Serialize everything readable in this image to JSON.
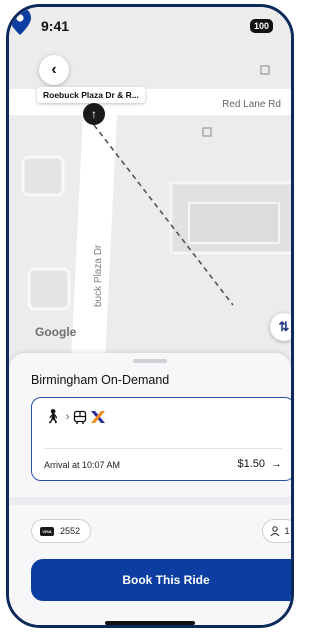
{
  "status_bar": {
    "time": "9:41",
    "battery": "100"
  },
  "map": {
    "stop_label": "Roebuck Plaza Dr & R...",
    "road_horizontal": "Red Lane Rd",
    "road_vertical": "buck Plaza Dr",
    "logo": "Google"
  },
  "sheet": {
    "title": "Birmingham On-Demand",
    "option": {
      "arrival": "Arrival at 10:07 AM",
      "price": "$1.50",
      "modes": [
        "walk-icon",
        "bus-icon",
        "transit-x-logo"
      ]
    },
    "payment": {
      "card_type": "VISA",
      "last4": "2552"
    },
    "riders": "1",
    "book_label": "Book This Ride"
  },
  "colors": {
    "accent": "#0b3ea0",
    "frame": "#0b2a5b",
    "pin": "#0b3ea0"
  }
}
